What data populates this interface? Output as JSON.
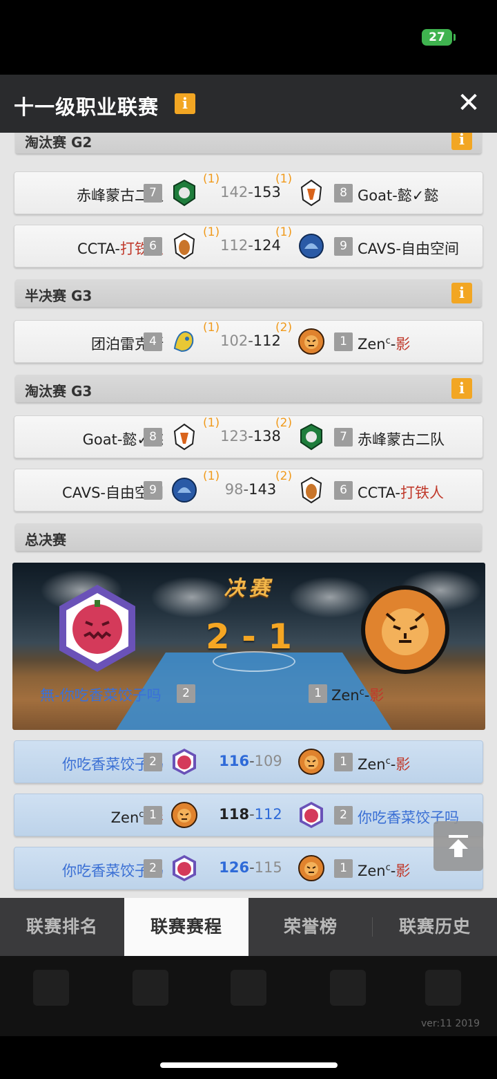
{
  "status": {
    "battery": "27"
  },
  "header": {
    "title": "十一级职业联赛",
    "info_icon": "i"
  },
  "sections": {
    "top_cut": "淘汰赛 G2",
    "semi_g3": "半决赛 G3",
    "elim_g3": "淘汰赛 G3",
    "finals": "总决赛"
  },
  "matches": [
    {
      "left_team": "赤峰蒙古二队",
      "left_seed": "7",
      "left_games": "(1)",
      "left_score": "142",
      "right_score": "153",
      "right_games": "(1)",
      "right_seed": "8",
      "right_team": "Goat-懿✓懿"
    },
    {
      "left_team_a": "CCTA-",
      "left_team_b": "打铁人",
      "left_seed": "6",
      "left_games": "(1)",
      "left_score": "112",
      "right_score": "124",
      "right_games": "(1)",
      "right_seed": "9",
      "right_team": "CAVS-自由空间"
    },
    {
      "left_team": "团泊雷克斯",
      "left_seed": "4",
      "left_games": "(1)",
      "left_score": "102",
      "right_score": "112",
      "right_games": "(2)",
      "right_seed": "1",
      "right_team_a": "Zen",
      "right_team_sup": "c",
      "right_team_b": "-",
      "right_team_c": "影"
    },
    {
      "left_team": "Goat-懿✓懿",
      "left_seed": "8",
      "left_games": "(1)",
      "left_score": "123",
      "right_score": "138",
      "right_games": "(2)",
      "right_seed": "7",
      "right_team": "赤峰蒙古二队"
    },
    {
      "left_team": "CAVS-自由空间",
      "left_seed": "9",
      "left_games": "(1)",
      "left_score": "98",
      "right_score": "143",
      "right_games": "(2)",
      "right_seed": "6",
      "right_team_a": "CCTA-",
      "right_team_b": "打铁人"
    }
  ],
  "finals": {
    "title": "决赛",
    "score": "2 - 1",
    "left_team": "無-你吃香菜饺子吗",
    "left_seed": "2",
    "right_seed": "1",
    "right_team_a": "Zen",
    "right_team_sup": "c",
    "right_team_b": "-",
    "right_team_c": "影"
  },
  "final_games": [
    {
      "left": "你吃香菜饺子吗",
      "left_seed": "2",
      "s1": "116",
      "s2": "109",
      "right_seed": "1",
      "right": "Zenᶜ-影"
    },
    {
      "left": "Zenᶜ-影",
      "left_seed": "1",
      "s1": "118",
      "s2": "112",
      "right_seed": "2",
      "right": "你吃香菜饺子吗"
    },
    {
      "left": "你吃香菜饺子吗",
      "left_seed": "2",
      "s1": "126",
      "s2": "115",
      "right_seed": "1",
      "right": "Zenᶜ-影"
    }
  ],
  "zen": {
    "a": "Zen",
    "sup": "c",
    "b": "-",
    "c": "影"
  },
  "dash": "-",
  "tabs": [
    "联赛排名",
    "联赛赛程",
    "荣誉榜",
    "联赛历史"
  ],
  "version": "ver:11  2019",
  "colors": {
    "accent": "#f2a623",
    "win_blue": "#2e6ad8",
    "red": "#c0392b"
  }
}
